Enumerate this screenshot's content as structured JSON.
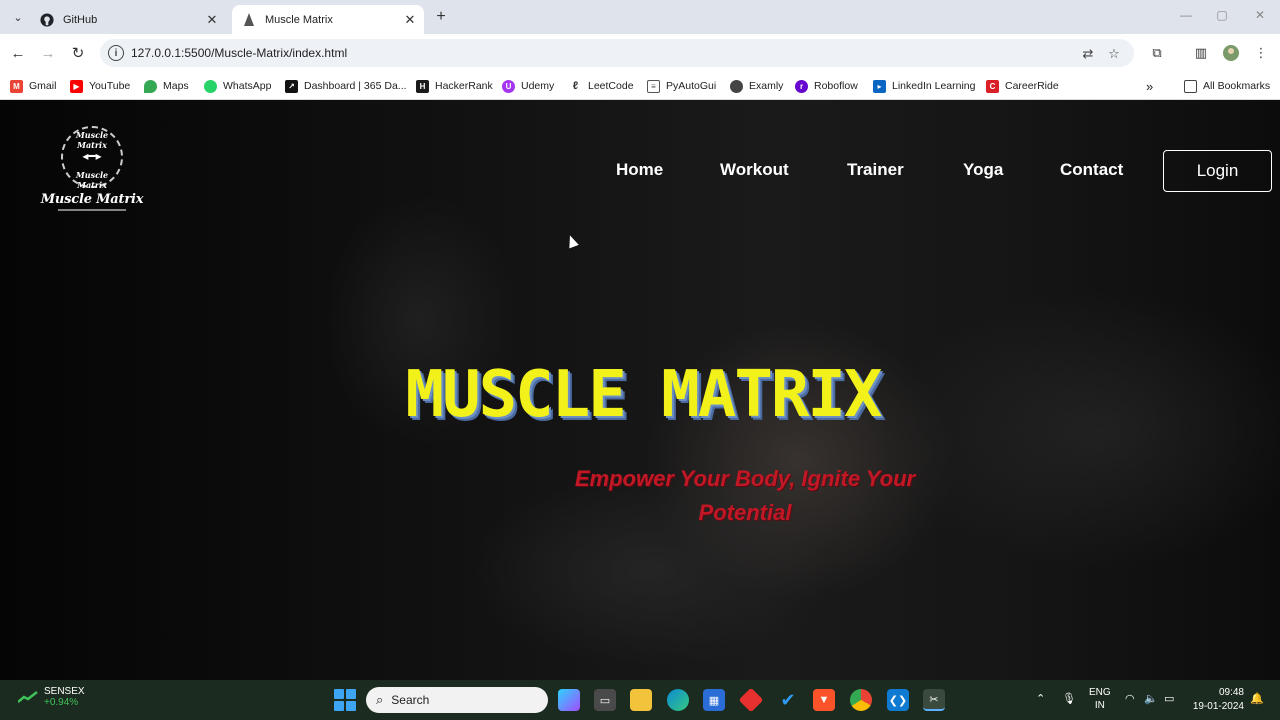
{
  "browser": {
    "tabs": [
      {
        "title": "GitHub",
        "favicon": "github-icon",
        "active": false
      },
      {
        "title": "Muscle Matrix",
        "favicon": "muscle-matrix-icon",
        "active": true
      }
    ],
    "url": "127.0.0.1:5500/Muscle-Matrix/index.html",
    "bookmarks": [
      {
        "label": "Gmail",
        "icon": "gmail-icon",
        "color": "#ea4335"
      },
      {
        "label": "YouTube",
        "icon": "youtube-icon",
        "color": "#ff0000"
      },
      {
        "label": "Maps",
        "icon": "maps-icon",
        "color": "#34a853"
      },
      {
        "label": "WhatsApp",
        "icon": "whatsapp-icon",
        "color": "#25d366"
      },
      {
        "label": "Dashboard | 365 Da...",
        "icon": "dashboard-icon",
        "color": "#111111"
      },
      {
        "label": "HackerRank",
        "icon": "hackerrank-icon",
        "color": "#1a1a1a"
      },
      {
        "label": "Udemy",
        "icon": "udemy-icon",
        "color": "#a435f0"
      },
      {
        "label": "LeetCode",
        "icon": "leetcode-icon",
        "color": "#333333"
      },
      {
        "label": "PyAutoGui",
        "icon": "pyautogui-icon",
        "color": "#555555"
      },
      {
        "label": "Examly",
        "icon": "examly-icon",
        "color": "#444444"
      },
      {
        "label": "Roboflow",
        "icon": "roboflow-icon",
        "color": "#6706ce"
      },
      {
        "label": "LinkedIn Learning",
        "icon": "linkedin-learning-icon",
        "color": "#0a66c2"
      },
      {
        "label": "CareerRide",
        "icon": "careerride-icon",
        "color": "#d92027"
      }
    ],
    "all_bookmarks": "All Bookmarks"
  },
  "site": {
    "logo": {
      "ring_top": "Muscle Matrix",
      "ring_bottom": "Muscle Matrix",
      "brand": "Muscle Matrix"
    },
    "nav": [
      "Home",
      "Workout",
      "Trainer",
      "Yoga",
      "Contact"
    ],
    "login": "Login",
    "hero_title": "MUSCLE MATRIX",
    "hero_subtitle": "Empower Your Body, Ignite Your Potential",
    "colors": {
      "title": "#f2f21a",
      "subtitle": "#c21826"
    }
  },
  "taskbar": {
    "widget_name": "SENSEX",
    "widget_value": "+0.94%",
    "search": "Search",
    "lang_top": "ENG",
    "lang_bottom": "IN",
    "time": "09:48",
    "date": "19-01-2024"
  }
}
